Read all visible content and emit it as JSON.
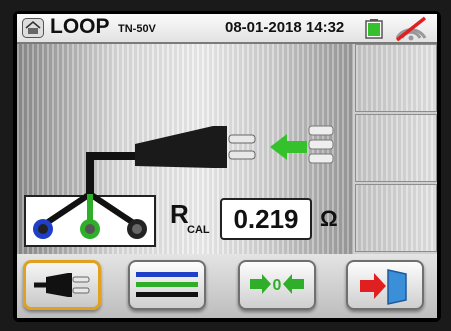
{
  "header": {
    "title": "LOOP",
    "subtitle": "TN-50V",
    "datetime": "08-01-2018 14:32",
    "icons": [
      "home-icon",
      "battery-icon",
      "no-signal-icon"
    ]
  },
  "measurement": {
    "label_main": "R",
    "label_sub": "CAL",
    "value": "0.219",
    "unit": "Ω"
  },
  "toolbar": {
    "buttons": [
      {
        "icon": "plug-icon",
        "selected": true
      },
      {
        "icon": "cable-leads-icon",
        "selected": false
      },
      {
        "icon": "zero-calibration-icon",
        "label": "0",
        "selected": false
      },
      {
        "icon": "exit-door-icon",
        "selected": false
      }
    ]
  },
  "colors": {
    "accent_green": "#35c12c",
    "selected_border": "#e0a020",
    "lead_blue": "#1f3fc8",
    "lead_green": "#2fae2a",
    "exit_red": "#e02020"
  }
}
